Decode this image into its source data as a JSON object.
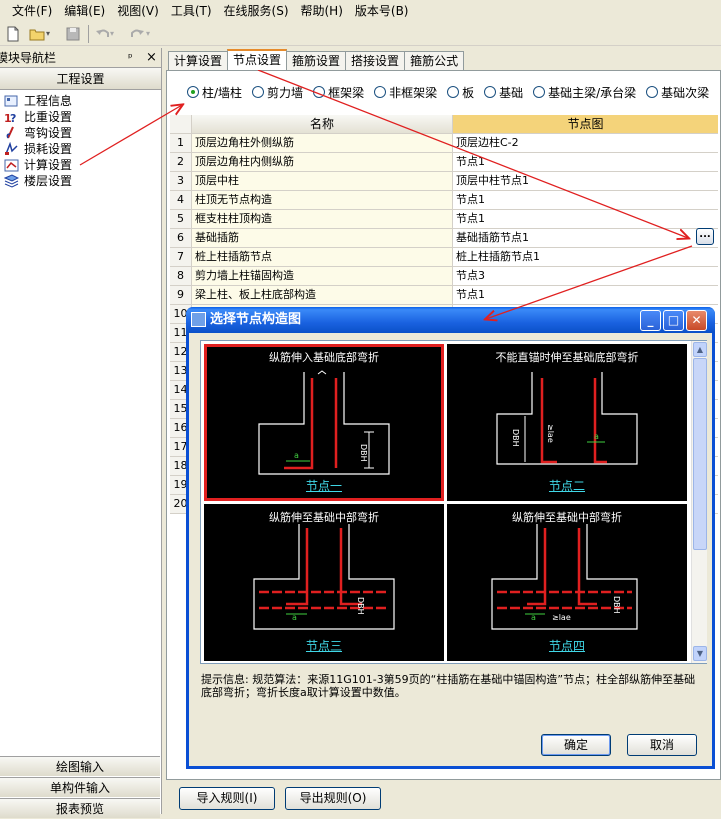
{
  "menu": [
    "文件(F)",
    "编辑(E)",
    "视图(V)",
    "工具(T)",
    "在线服务(S)",
    "帮助(H)",
    "版本号(B)"
  ],
  "nav": {
    "title": "模块导航栏",
    "pin": "ᵖ",
    "close": "×",
    "header": "工程设置",
    "items": [
      {
        "label": "工程信息",
        "icon": "info-icon"
      },
      {
        "label": "比重设置",
        "icon": "weight-icon"
      },
      {
        "label": "弯钩设置",
        "icon": "hook-icon"
      },
      {
        "label": "损耗设置",
        "icon": "loss-icon"
      },
      {
        "label": "计算设置",
        "icon": "calc-icon"
      },
      {
        "label": "楼层设置",
        "icon": "floor-icon"
      }
    ],
    "bottom": [
      "绘图输入",
      "单构件输入",
      "报表预览"
    ]
  },
  "tabs": [
    "计算设置",
    "节点设置",
    "箍筋设置",
    "搭接设置",
    "箍筋公式"
  ],
  "active_tab": 1,
  "radios": [
    {
      "label": "柱/墙柱",
      "checked": true
    },
    {
      "label": "剪力墙",
      "checked": false
    },
    {
      "label": "框架梁",
      "checked": false
    },
    {
      "label": "非框架梁",
      "checked": false
    },
    {
      "label": "板",
      "checked": false
    },
    {
      "label": "基础",
      "checked": false
    },
    {
      "label": "基础主梁/承台梁",
      "checked": false
    },
    {
      "label": "基础次梁",
      "checked": false
    }
  ],
  "grid": {
    "headers": {
      "name": "名称",
      "node": "节点图"
    },
    "rows": [
      {
        "num": "1",
        "name": "顶层边角柱外侧纵筋",
        "node": "顶层边柱C-2"
      },
      {
        "num": "2",
        "name": "顶层边角柱内侧纵筋",
        "node": "节点1"
      },
      {
        "num": "3",
        "name": "顶层中柱",
        "node": "顶层中柱节点1"
      },
      {
        "num": "4",
        "name": "柱顶无节点构造",
        "node": "节点1"
      },
      {
        "num": "5",
        "name": "框支柱柱顶构造",
        "node": "节点1"
      },
      {
        "num": "6",
        "name": "基础插筋",
        "node": "基础插筋节点1"
      },
      {
        "num": "7",
        "name": "桩上柱插筋节点",
        "node": "桩上柱插筋节点1"
      },
      {
        "num": "8",
        "name": "剪力墙上柱锚固构造",
        "node": "节点3"
      },
      {
        "num": "9",
        "name": "梁上柱、板上柱底部构造",
        "node": "节点1"
      },
      {
        "num": "10",
        "name": "",
        "node": ""
      },
      {
        "num": "11",
        "name": "",
        "node": ""
      },
      {
        "num": "12",
        "name": "",
        "node": ""
      },
      {
        "num": "13",
        "name": "",
        "node": ""
      },
      {
        "num": "14",
        "name": "",
        "node": ""
      },
      {
        "num": "15",
        "name": "",
        "node": ""
      },
      {
        "num": "16",
        "name": "",
        "node": ""
      },
      {
        "num": "17",
        "name": "",
        "node": ""
      },
      {
        "num": "18",
        "name": "",
        "node": ""
      },
      {
        "num": "19",
        "name": "",
        "node": ""
      },
      {
        "num": "20",
        "name": "",
        "node": ""
      }
    ],
    "ellipsis": "..."
  },
  "buttons": {
    "import": "导入规则(I)",
    "export": "导出规则(O)"
  },
  "dialog": {
    "title": "选择节点构造图",
    "thumbs": [
      {
        "title": "纵筋伸入基础底部弯折",
        "caption": "节点一",
        "selected": true
      },
      {
        "title": "不能直锚时伸至基础底部弯折",
        "caption": "节点二",
        "selected": false
      },
      {
        "title": "纵筋伸至基础中部弯折",
        "caption": "节点三",
        "selected": false
      },
      {
        "title": "纵筋伸至基础中部弯折",
        "caption": "节点四",
        "selected": false
      }
    ],
    "drawing_labels": {
      "dbh": "DBH",
      "a": "a",
      "lae": "≥lae"
    },
    "hint": "提示信息: 规范算法：来源11G101-3第59页的“柱插筋在基础中锚固构造”节点；柱全部纵筋伸至基础底部弯折；弯折长度a取计算设置中数值。",
    "ok": "确定",
    "cancel": "取消"
  }
}
